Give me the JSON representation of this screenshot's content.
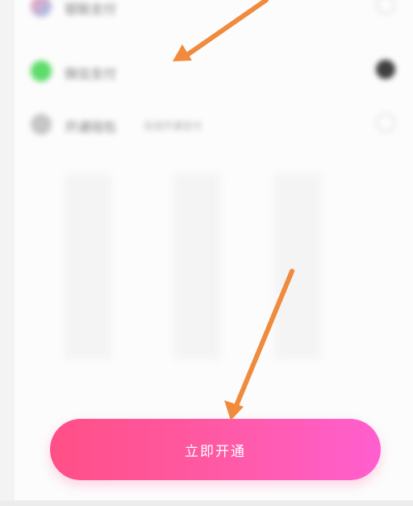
{
  "payment_options": [
    {
      "label": "银联支付",
      "sublabel": "",
      "icon": "unionpay-icon",
      "icon_color": "#d9b9e4",
      "selected": false
    },
    {
      "label": "微信支付",
      "sublabel": "",
      "icon": "wechat-pay-icon",
      "icon_color": "#5edb6b",
      "selected": true
    },
    {
      "label": "开通钱包",
      "sublabel": "在线开通支付",
      "icon": "wallet-icon",
      "icon_color": "#c6c6c6",
      "selected": false
    }
  ],
  "cta": {
    "label": "立即开通",
    "gradient_start": "#ff4f86",
    "gradient_end": "#ff5fcf"
  },
  "annotations": {
    "arrow_color": "#f08a3c"
  }
}
